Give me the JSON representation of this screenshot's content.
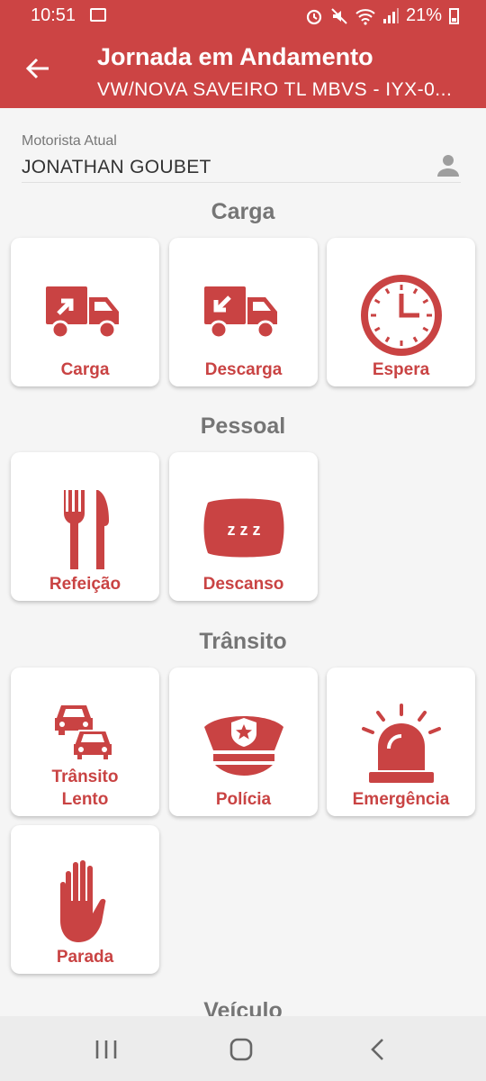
{
  "status_bar": {
    "time": "10:51",
    "battery": "21%"
  },
  "app_bar": {
    "title": "Jornada em Andamento",
    "subtitle": "VW/NOVA SAVEIRO TL MBVS - IYX-0..."
  },
  "driver": {
    "label": "Motorista Atual",
    "name": "JONATHAN GOUBET"
  },
  "sections": {
    "carga": "Carga",
    "pessoal": "Pessoal",
    "transito": "Trânsito",
    "veiculo": "Veículo"
  },
  "actions": {
    "carga": "Carga",
    "descarga": "Descarga",
    "espera": "Espera",
    "refeicao": "Refeição",
    "descanso": "Descanso",
    "transito_lento_line1": "Trânsito",
    "transito_lento_line2": "Lento",
    "policia": "Polícia",
    "emergencia": "Emergência",
    "parada": "Parada"
  },
  "colors": {
    "accent": "#cc4444",
    "icon": "#c94343"
  }
}
